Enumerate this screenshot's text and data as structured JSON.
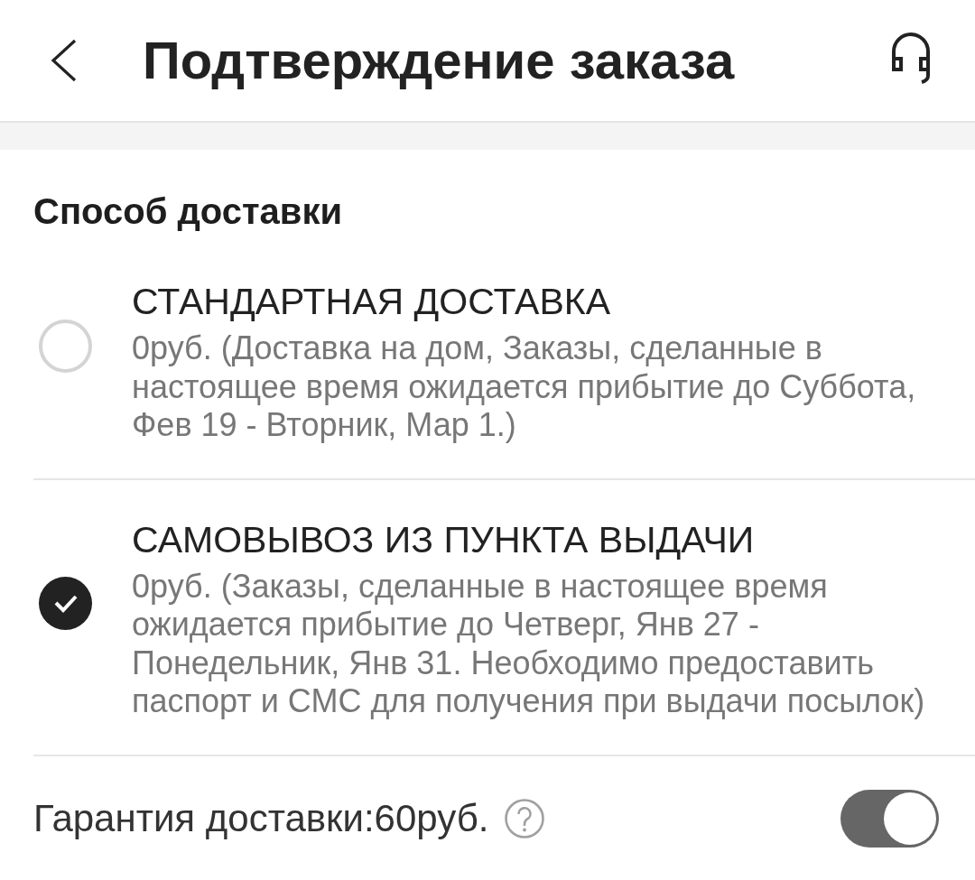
{
  "header": {
    "title": "Подтверждение заказа"
  },
  "delivery": {
    "title": "Способ доставки",
    "options": [
      {
        "name": "СТАНДАРТНАЯ ДОСТАВКА",
        "description": "0руб. (Доставка на дом, Заказы, сделанные в настоящее время ожидается прибытие до Суббота, Фев 19 - Вторник, Мар 1.)",
        "selected": false
      },
      {
        "name": "САМОВЫВОЗ ИЗ ПУНКТА ВЫДАЧИ",
        "description": "0руб. (Заказы, сделанные в настоящее время ожидается прибытие до Четверг, Янв 27 - Понедельник, Янв 31. Необходимо предоставить паспорт и СМС для получения при выдачи посылок)",
        "selected": true
      }
    ]
  },
  "guarantee": {
    "label": "Гарантия доставки:60руб.",
    "on": true
  }
}
